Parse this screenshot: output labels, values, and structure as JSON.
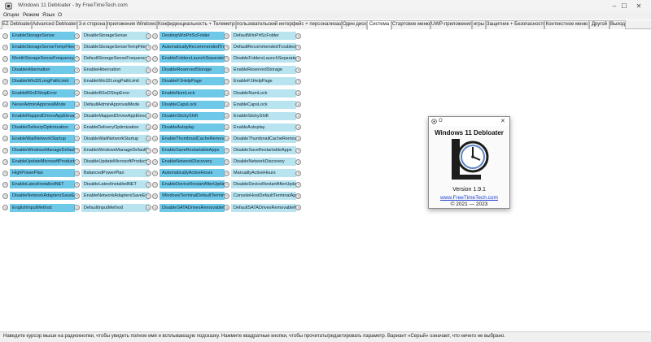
{
  "window": {
    "title": "Windows 11 Debloater - by FreeTimeTech.com",
    "controls": [
      "–",
      "☐",
      "✕"
    ]
  },
  "menu": [
    "Опции",
    "Режим",
    "Язык",
    "О"
  ],
  "tabs": [
    "EZ Debloater",
    "Advanced Debloater",
    "3-я сторона",
    "приложения Windows",
    "Конфиденциальность + Телеметрия",
    "пользовательский интерфейс + персонализация",
    "Один диск",
    "Система",
    "Стартовое меню",
    "UWP-приложения",
    "игры",
    "Защитник + Безопасность",
    "Контекстное меню",
    "Другой",
    "Выход"
  ],
  "active_tab": "Система",
  "columns": [
    {
      "items": [
        "EnableStorageSense",
        "EnableStorageSenseTempFiles",
        "MonthStorageSenseFrequency",
        "DisableHibernation",
        "DisableWin32LongPathLimit",
        "EnableBSoDStopError",
        "NeverAdminApprovalMode",
        "EnableMappedDrivesAppElevatedAccess",
        "DisableDeliveryOptimization",
        "EnableWaitNetworkStartup",
        "DisableWindowsManageDefaultPrinter",
        "EnableUpdateMicrosoftProducts",
        "HighPowerPlan",
        "EnableLatestInstalledNET",
        "DisableNetworkAdaptersSaveEnergy",
        "EnglishInputMethod"
      ]
    },
    {
      "items": [
        "DisableStorageSense",
        "DisableStorageSenseTempFiles",
        "DefaultStorageSenseFrequency",
        "EnableHibernation",
        "EnableWin32LongPathLimit",
        "DisableBSoDStopError",
        "DefaultAdminApprovalMode",
        "DisableMappedDrivesAppElevatedAccess",
        "EnableDeliveryOptimization",
        "DisableWaitNetworkStartup",
        "EnableWindowsManageDefaultPrinter",
        "DisableUpdateMicrosoftProducts",
        "BalancedPowerPlan",
        "DisableLatestInstalledNET",
        "EnableNetworkAdaptersSaveEnergy",
        "DefaultInputMethod"
      ]
    },
    {
      "items": [
        "DesktopWinPrtScFolder",
        "AutomaticallyRecommendedTroubleshooting",
        "EnableFoldersLaunchSeparateProcess",
        "DisableReservedStorage",
        "DisableF1HelpPage",
        "EnableNumLock",
        "DisableCapsLock",
        "DisableStickyShift",
        "DisableAutoplay",
        "EnableThumbnailCacheRemoval",
        "EnableSaveRestartableApps",
        "EnableNetworkDiscovery",
        "AutomaticallyActiveHours",
        "EnableDeviceRestartAfterUpdate",
        "WindowsTerminalDefaultTerminalApp",
        "DisableSATADrivesRemovableMedia"
      ]
    },
    {
      "items": [
        "DefaultWinPrtScFolder",
        "DefaultRecommendedTroubleshooting",
        "DisableFoldersLaunchSeparateProcess",
        "EnableReservedStorage",
        "EnableF1HelpPage",
        "DisableNumLock",
        "EnableCapsLock",
        "EnableStickyShift",
        "EnableAutoplay",
        "DisableThumbnailCacheRemoval",
        "DisableSaveRestartableApps",
        "DisableNetworkDiscovery",
        "ManuallyActiveHours",
        "DisableDeviceRestartAfterUpdate",
        "ConsoleHostDefaultTerminalApp",
        "DefaultSATADrivesRemovableMedia"
      ]
    }
  ],
  "status_bar": "Наведите курсор мыши на радиокнопки, чтобы увидеть полное имя и всплывающую подсказку. Нажмите квадратные кнопки, чтобы прочитать/редактировать параметр. Вариант «Серый» означает, что ничего не выбрано.",
  "about_dialog": {
    "title": "О",
    "app_name": "Windows 11 Debloater",
    "version": "Version 1.9.1",
    "link": "www.FreeTimeTech.com",
    "copyright": "© 2021 — 2023",
    "close": "✕"
  },
  "colors": {
    "enable_button": "#6ec8e8",
    "disable_button": "#b8e4f0",
    "link": "#1a3fcf"
  }
}
